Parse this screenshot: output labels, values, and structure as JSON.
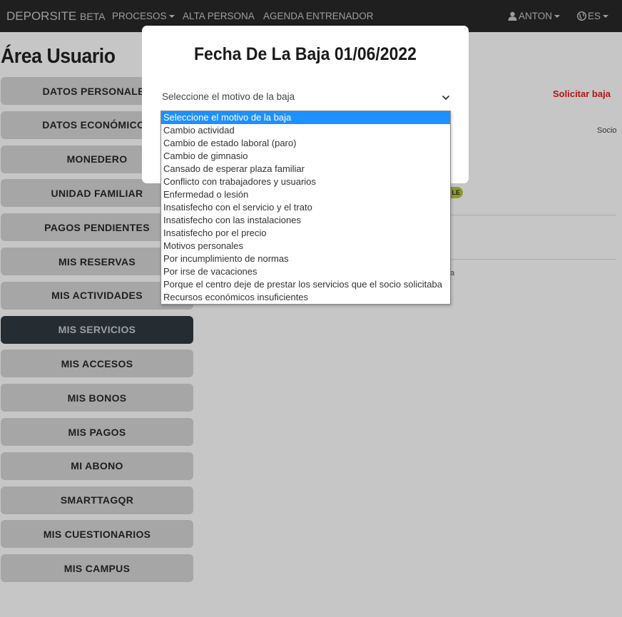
{
  "navbar": {
    "brand": "DEPORSITE",
    "brand_suffix": "BETA",
    "procesos": "PROCESOS",
    "alta_persona": "ALTA PERSONA",
    "agenda": "AGENDA ENTRENADOR",
    "user": "ANTON",
    "language": "ES"
  },
  "page": {
    "title": "Área Usuario",
    "solicitar_baja": "Solicitar baja",
    "socio": "Socio",
    "badge_text": "LE",
    "partial_text": "a"
  },
  "sidebar": {
    "items": [
      {
        "label": "DATOS PERSONALES"
      },
      {
        "label": "DATOS ECONÓMICOS"
      },
      {
        "label": "MONEDERO"
      },
      {
        "label": "UNIDAD FAMILIAR"
      },
      {
        "label": "PAGOS PENDIENTES"
      },
      {
        "label": "MIS RESERVAS"
      },
      {
        "label": "MIS ACTIVIDADES"
      },
      {
        "label": "MIS SERVICIOS"
      },
      {
        "label": "MIS ACCESOS"
      },
      {
        "label": "MIS BONOS"
      },
      {
        "label": "MIS PAGOS"
      },
      {
        "label": "MI ABONO"
      },
      {
        "label": "SMARTTAGQR"
      },
      {
        "label": "MIS CUESTIONARIOS"
      },
      {
        "label": "MIS CAMPUS"
      }
    ],
    "active_index": 7
  },
  "modal": {
    "title": "Fecha De La Baja 01/06/2022",
    "select_value": "Seleccione el motivo de la baja",
    "options": [
      "Seleccione el motivo de la baja",
      "Cambio actividad",
      "Cambio de estado laboral (paro)",
      "Cambio de gimnasio",
      "Cansado de esperar plaza familiar",
      "Conflicto con trabajadores y usuarios",
      "Enfermedad o lesión",
      "Insatisfecho con el servicio y el trato",
      "Insatisfecho con las instalaciones",
      "Insatisfecho por el precio",
      "Motivos personales",
      "Por incumplimiento de normas",
      "Por irse de vacaciones",
      "Porque el centro deje de prestar los servicios que el socio solicitaba",
      "Recursos económicos insuficientes"
    ],
    "selected_option_index": 0
  },
  "colors": {
    "navbar_bg": "#1f1f1f",
    "active_item_bg": "#252d33",
    "accent_red": "#b31515",
    "highlight_blue": "#1e90ff"
  }
}
